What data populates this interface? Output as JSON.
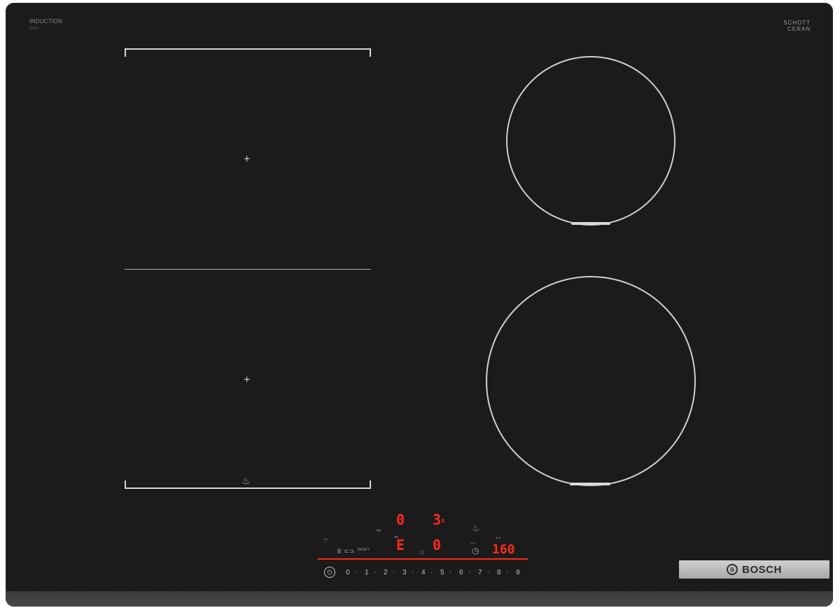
{
  "brand_top_left": {
    "line1": "INDUCTION",
    "line2": "PVS7..."
  },
  "brand_top_right": {
    "line1": "SCHOTT",
    "line2": "CERAN",
    "line3": "..."
  },
  "cooktop": {
    "flex_zone_marks": [
      "+",
      "+"
    ],
    "right_zones": [
      "rear-ring",
      "front-ring"
    ]
  },
  "control_panel": {
    "displays": {
      "top_left_digit": "0",
      "top_right_digits": "3",
      "top_right_unit": "s",
      "mid_left_symbol": "E",
      "mid_right_digit": "0",
      "timer_value": "160"
    },
    "buttons": {
      "pause_label": "II",
      "reset_label": "RESET",
      "power_symbol": "⏻"
    },
    "scale": [
      "0",
      "·",
      "1",
      "·",
      "2",
      "·",
      "3",
      "·",
      "4",
      "·",
      "5",
      "·",
      "6",
      "·",
      "7",
      "·",
      "8",
      "·",
      "9"
    ],
    "colors": {
      "display": "#ff2a1a",
      "glass": "#1b1b1b"
    }
  },
  "brand_plate": {
    "label": "BOSCH",
    "logo_letter": "B"
  }
}
